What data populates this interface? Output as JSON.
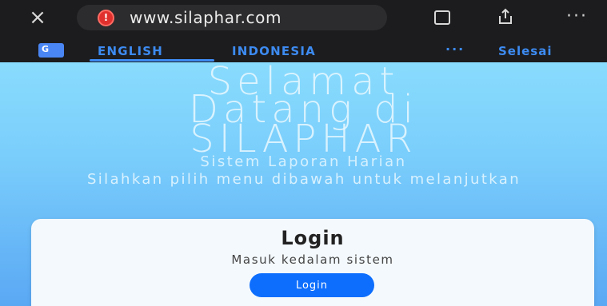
{
  "browser": {
    "close_icon": "close-icon",
    "security_icon": "warning-icon",
    "security_glyph": "!",
    "url": "www.silaphar.com",
    "bookmark_icon": "bookmark-icon",
    "share_icon": "share-icon",
    "more": "···"
  },
  "translate_bar": {
    "icon": "google-translate-icon",
    "icon_text": "G",
    "languages": [
      "ENGLISH",
      "INDONESIA"
    ],
    "more": "···",
    "done_label": "Selesai"
  },
  "page": {
    "title_lines": [
      "Selamat",
      "Datang di",
      "SILAPHAR"
    ],
    "subtitle": "Sistem Laporan Harian",
    "instruction": "Silahkan pilih menu dibawah untuk melanjutkan",
    "card": {
      "title": "Login",
      "subtitle": "Masuk kedalam sistem",
      "button_label": "Login"
    }
  },
  "colors": {
    "accent": "#3d8bf2",
    "button": "#0d6efd",
    "page_bg_top": "#89dcfd",
    "page_bg_bottom": "#5aa8f4"
  }
}
